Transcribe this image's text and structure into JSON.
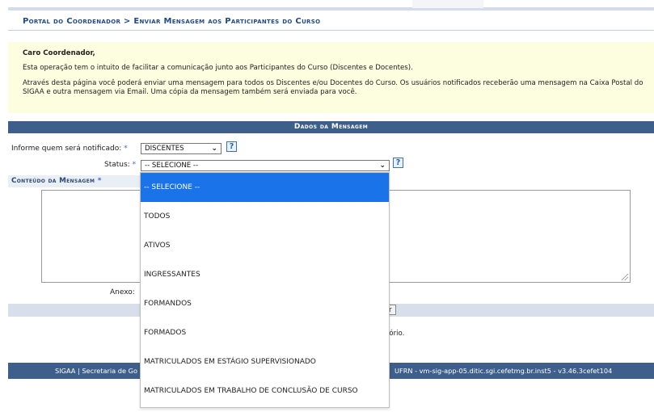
{
  "breadcrumb": "Portal do Coordenador > Enviar Mensagem aos Participantes do Curso",
  "info": {
    "greeting": "Caro Coordenador,",
    "paragraph1": "Esta operação tem o intuito de facilitar a comunicação junto aos Participantes do Curso (Discentes e Docentes).",
    "paragraph2": "Através desta página você poderá enviar uma mensagem para todos os Discentes e/ou Docentes do Curso. Os usuários notificados receberão uma mensagem na Caixa Postal do SIGAA e outra mensagem via Email. Uma cópia da mensagem também será enviada para você."
  },
  "form": {
    "section_title": "Dados da Mensagem",
    "notify_label": "Informe quem será notificado:",
    "notify_value": "DISCENTES",
    "status_label": "Status:",
    "status_value": "-- SELECIONE --",
    "content_label": "Conteúdo da Mensagem",
    "required_marker": "*",
    "help_glyph": "?",
    "anexo_label": "Anexo:",
    "button_stub": "r",
    "obrigatorio_stub": "tório."
  },
  "dropdown": {
    "options": [
      "-- SELECIONE --",
      "TODOS",
      "ATIVOS",
      "INGRESSANTES",
      "FORMANDOS",
      "FORMADOS",
      "MATRICULADOS EM ESTÁGIO SUPERVISIONADO",
      "MATRICULADOS EM TRABALHO DE CONCLUSÃO DE CURSO"
    ],
    "selected_index": 0
  },
  "footer": {
    "left": "SIGAA | Secretaria de Go",
    "right": "UFRN - vm-sig-app-05.ditic.sgi.cefetmg.br.inst5 - v3.46.3cefet104"
  },
  "colors": {
    "header_blue": "#3e5e8c",
    "breadcrumb_text": "#1f4a86",
    "info_bg": "#fdfde0",
    "selected_option": "#1a73e8"
  }
}
